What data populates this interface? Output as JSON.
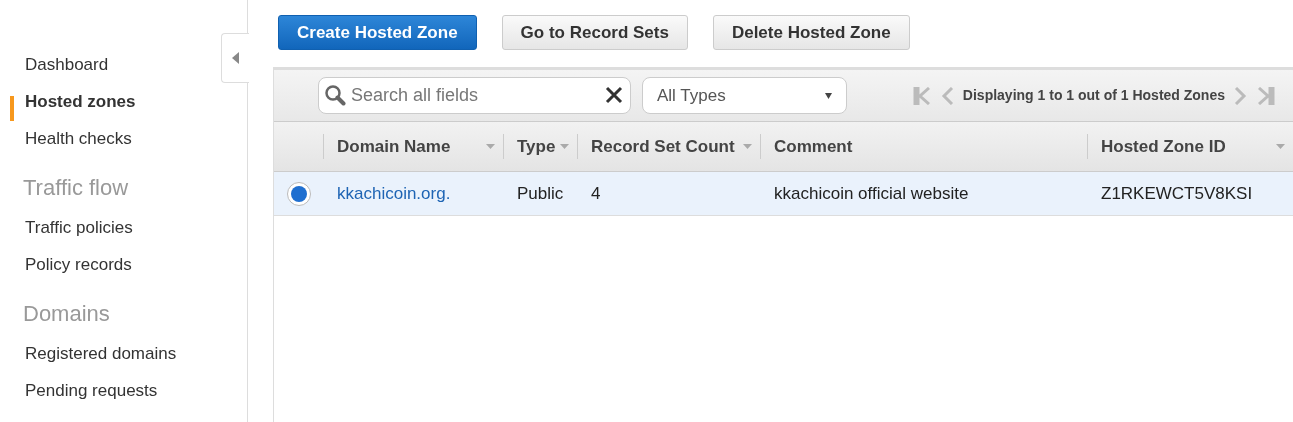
{
  "sidebar": {
    "items": [
      {
        "kind": "item",
        "label": "Dashboard",
        "selected": false
      },
      {
        "kind": "item",
        "label": "Hosted zones",
        "selected": true
      },
      {
        "kind": "item",
        "label": "Health checks",
        "selected": false
      },
      {
        "kind": "heading",
        "label": "Traffic flow"
      },
      {
        "kind": "item",
        "label": "Traffic policies",
        "selected": false
      },
      {
        "kind": "item",
        "label": "Policy records",
        "selected": false
      },
      {
        "kind": "heading",
        "label": "Domains"
      },
      {
        "kind": "item",
        "label": "Registered domains",
        "selected": false
      },
      {
        "kind": "item",
        "label": "Pending requests",
        "selected": false
      }
    ]
  },
  "actions": [
    {
      "label": "Create Hosted Zone",
      "primary": true
    },
    {
      "label": "Go to Record Sets",
      "primary": false
    },
    {
      "label": "Delete Hosted Zone",
      "primary": false
    }
  ],
  "search": {
    "placeholder": "Search all fields"
  },
  "type_filter": {
    "value": "All Types"
  },
  "pagination": {
    "text": "Displaying 1 to 1 out of 1 Hosted Zones"
  },
  "table": {
    "columns": [
      {
        "label": "Domain Name",
        "sortable": true
      },
      {
        "label": "Type",
        "sortable": true
      },
      {
        "label": "Record Set Count",
        "sortable": true
      },
      {
        "label": "Comment",
        "sortable": false
      },
      {
        "label": "Hosted Zone ID",
        "sortable": true
      }
    ],
    "rows": [
      {
        "selected": true,
        "cells": [
          "kkachicoin.org.",
          "Public",
          "4",
          "kkachicoin official website",
          "Z1RKEWCT5V8KSI"
        ]
      }
    ]
  }
}
